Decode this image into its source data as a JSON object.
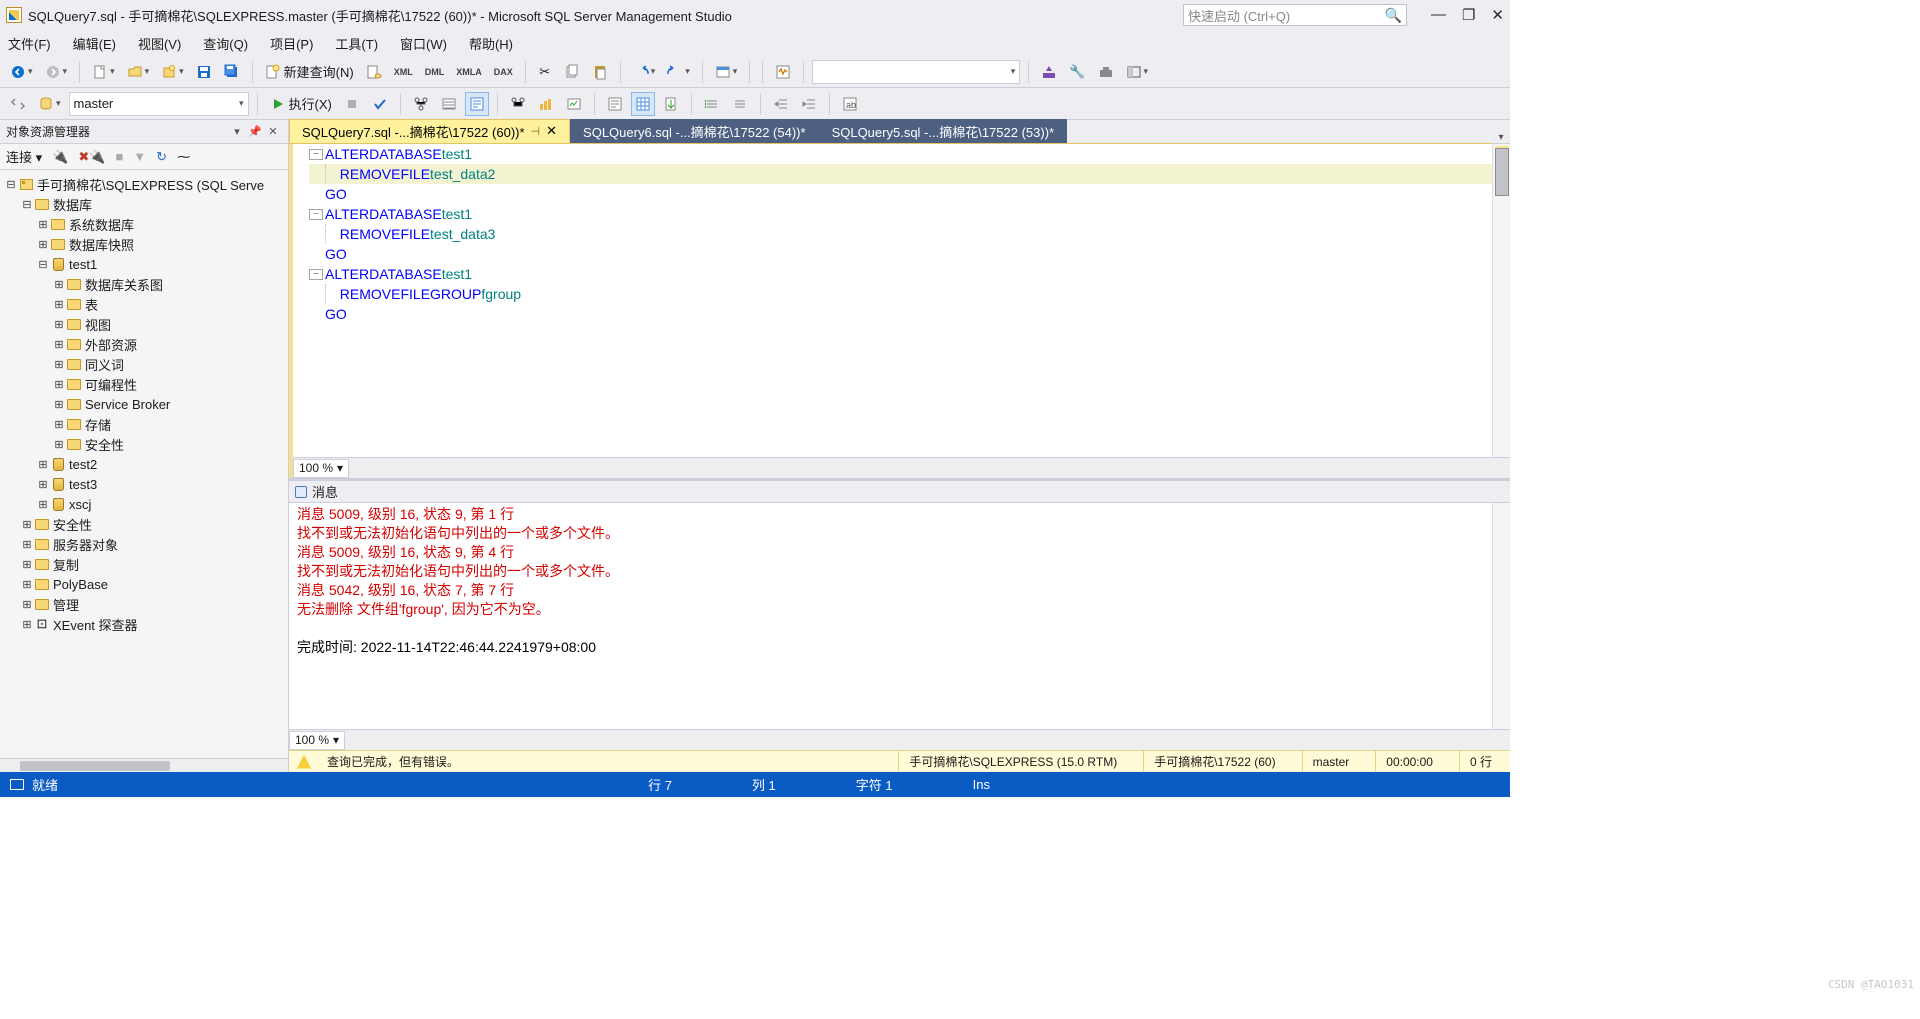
{
  "title": "SQLQuery7.sql - 手可摘棉花\\SQLEXPRESS.master (手可摘棉花\\17522 (60))* - Microsoft SQL Server Management Studio",
  "quicklaunch_placeholder": "快速启动 (Ctrl+Q)",
  "menu": {
    "file": "文件(F)",
    "edit": "编辑(E)",
    "view": "视图(V)",
    "query": "查询(Q)",
    "project": "项目(P)",
    "tools": "工具(T)",
    "window": "窗口(W)",
    "help": "帮助(H)"
  },
  "toolbar1": {
    "newquery": "新建查询(N)",
    "xml_icons": [
      "XML",
      "DML",
      "XMLA",
      "DAX"
    ]
  },
  "toolbar2": {
    "db": "master",
    "execute": "执行(X)"
  },
  "explorer": {
    "title": "对象资源管理器",
    "connect": "连接",
    "root": "手可摘棉花\\SQLEXPRESS (SQL Serve",
    "nodes": {
      "databases": "数据库",
      "sysdb": "系统数据库",
      "snapshot": "数据库快照",
      "test1": "test1",
      "t1_diag": "数据库关系图",
      "t1_tables": "表",
      "t1_views": "视图",
      "t1_ext": "外部资源",
      "t1_syn": "同义词",
      "t1_prog": "可编程性",
      "t1_sb": "Service Broker",
      "t1_storage": "存储",
      "t1_sec": "安全性",
      "test2": "test2",
      "test3": "test3",
      "xscj": "xscj",
      "security": "安全性",
      "serverobj": "服务器对象",
      "replication": "复制",
      "polybase": "PolyBase",
      "management": "管理",
      "xevent": "XEvent 探查器"
    }
  },
  "tabs": {
    "t1": "SQLQuery7.sql -...摘棉花\\17522 (60))*",
    "t2": "SQLQuery6.sql -...摘棉花\\17522 (54))*",
    "t3": "SQLQuery5.sql -...摘棉花\\17522 (53))*"
  },
  "code": {
    "l1a": "ALTER",
    "l1b": " DATABASE ",
    "l1c": "test1",
    "l2a": "REMOVE",
    "l2b": " FILE ",
    "l2c": "test_data2",
    "l3": "GO",
    "l4a": "ALTER",
    "l4b": " DATABASE ",
    "l4c": "test1",
    "l5a": "REMOVE",
    "l5b": " FILE ",
    "l5c": "test_data3",
    "l6": "GO",
    "l7a": "ALTER",
    "l7b": " DATABASE ",
    "l7c": "test1",
    "l8a": "REMOVE",
    "l8b": " FILEGROUP ",
    "l8c": "fgroup",
    "l9": "GO"
  },
  "zoom": "100 %",
  "msg_tab": "消息",
  "messages": {
    "m1": "消息 5009, 级别 16, 状态 9, 第 1 行",
    "m2": "找不到或无法初始化语句中列出的一个或多个文件。",
    "m3": "消息 5009, 级别 16, 状态 9, 第 4 行",
    "m4": "找不到或无法初始化语句中列出的一个或多个文件。",
    "m5": "消息 5042, 级别 16, 状态 7, 第 7 行",
    "m6": "无法删除 文件组'fgroup', 因为它不为空。",
    "m7": "完成时间: 2022-11-14T22:46:44.2241979+08:00"
  },
  "status": {
    "text": "查询已完成，但有错误。",
    "server": "手可摘棉花\\SQLEXPRESS (15.0 RTM)",
    "user": "手可摘棉花\\17522 (60)",
    "db": "master",
    "time": "00:00:00",
    "rows": "0 行"
  },
  "bluestatus": {
    "ready": "就绪",
    "line": "行 7",
    "col": "列 1",
    "char": "字符 1",
    "ins": "Ins"
  },
  "watermark": "CSDN @TAO1031"
}
